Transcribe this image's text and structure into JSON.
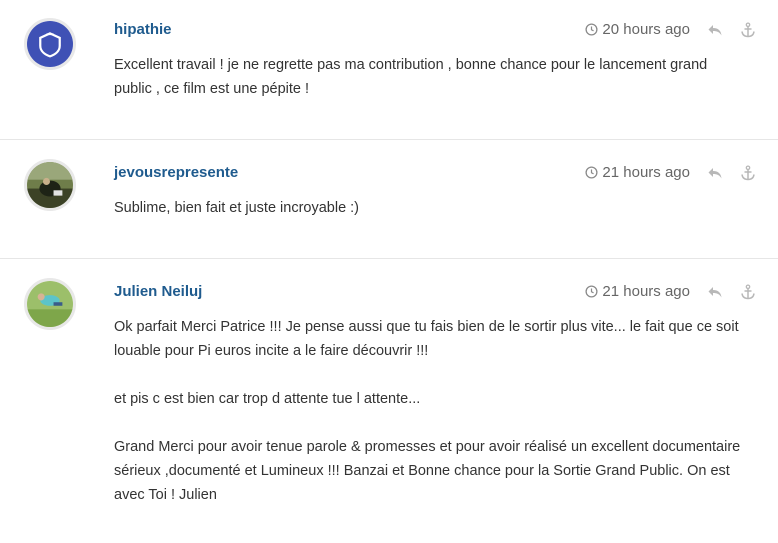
{
  "comments": [
    {
      "author": "hipathie",
      "time": "20 hours ago",
      "avatar_icon": "shield-avatar-icon",
      "paragraphs": [
        "Excellent travail ! je ne regrette pas ma contribution , bonne chance pour le lancement grand public , ce film est une pépite !"
      ]
    },
    {
      "author": "jevousrepresente",
      "time": "21 hours ago",
      "avatar_icon": "photo-avatar-icon",
      "paragraphs": [
        "Sublime, bien fait et juste incroyable :)"
      ]
    },
    {
      "author": "Julien Neiluj",
      "time": "21 hours ago",
      "avatar_icon": "photo-avatar-icon",
      "paragraphs": [
        "Ok parfait Merci Patrice !!! Je pense aussi que tu fais bien de le sortir plus vite... le fait que ce soit louable pour Pi euros incite a le faire découvrir !!!",
        "et pis c est bien car trop d attente tue l attente...",
        "Grand Merci pour avoir tenue parole & promesses et pour avoir réalisé un excellent documentaire sérieux ,documenté et Lumineux !!! Banzai et Bonne chance pour la Sortie Grand Public. On est avec Toi ! Julien"
      ]
    }
  ],
  "colors": {
    "author": "#1f5b8e",
    "meta": "#666666",
    "avatar_accent": "#3f51b5",
    "divider": "#e6e6e6"
  }
}
